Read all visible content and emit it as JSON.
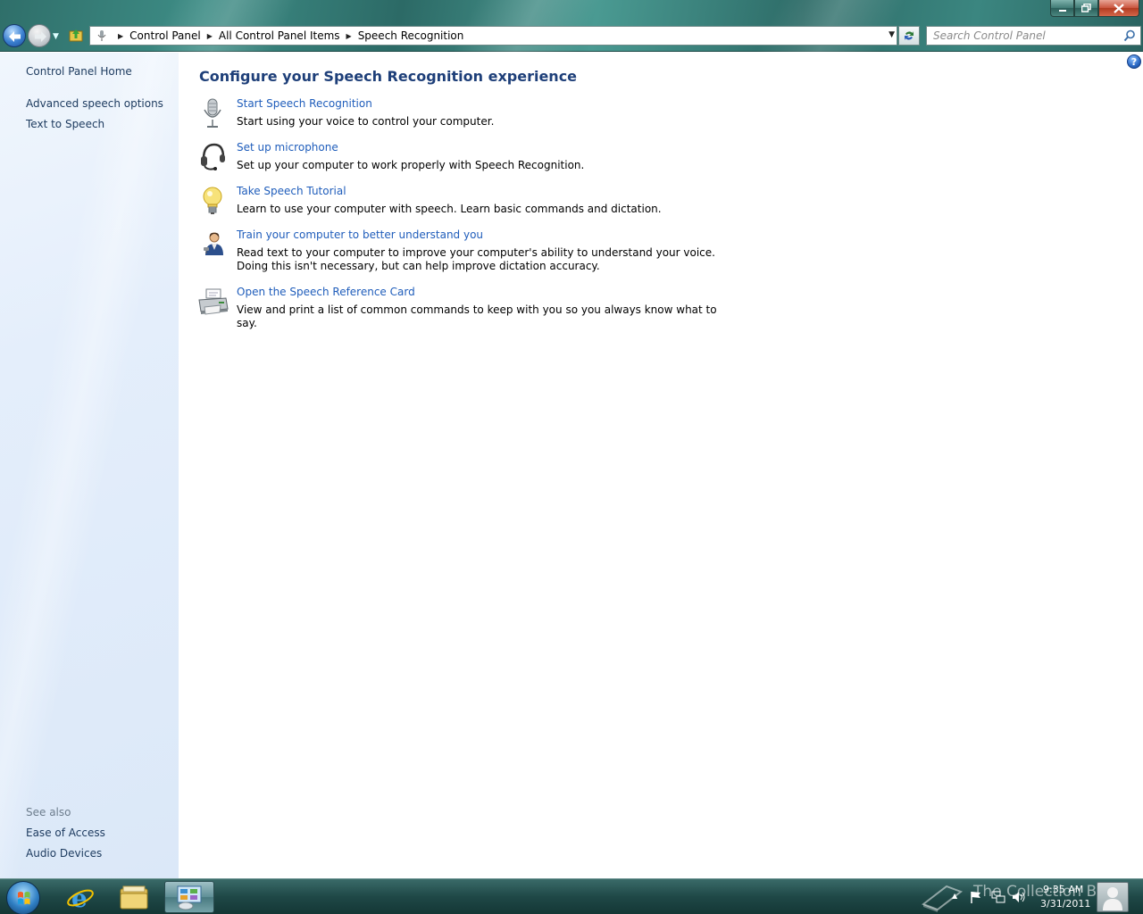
{
  "window": {
    "controls": {
      "minimize": "minimize",
      "maximize": "restore",
      "close": "close"
    }
  },
  "address_bar": {
    "crumbs": [
      "Control Panel",
      "All Control Panel Items",
      "Speech Recognition"
    ]
  },
  "search": {
    "placeholder": "Search Control Panel"
  },
  "sidebar": {
    "home": "Control Panel Home",
    "links": [
      "Advanced speech options",
      "Text to Speech"
    ],
    "see_also_heading": "See also",
    "see_also": [
      "Ease of Access",
      "Audio Devices"
    ]
  },
  "main": {
    "title": "Configure your Speech Recognition experience",
    "tasks": [
      {
        "icon": "microphone-icon",
        "link": "Start Speech Recognition",
        "desc": "Start using your voice to control your computer."
      },
      {
        "icon": "headset-icon",
        "link": "Set up microphone",
        "desc": "Set up your computer to work properly with Speech Recognition."
      },
      {
        "icon": "lightbulb-icon",
        "link": "Take Speech Tutorial",
        "desc": "Learn to use your computer with speech.  Learn basic commands and dictation."
      },
      {
        "icon": "user-training-icon",
        "link": "Train your computer to better understand you",
        "desc": "Read text to your computer to improve your computer's ability to understand your voice.  Doing this isn't necessary, but can help improve dictation accuracy."
      },
      {
        "icon": "printer-icon",
        "link": "Open the Speech Reference Card",
        "desc": "View and print a list of common commands to keep with you so you always know what to say."
      }
    ]
  },
  "taskbar": {
    "clock_time": "9:35 AM",
    "clock_date": "3/31/2011",
    "watermark": "The Collection Book",
    "pinned": [
      "internet-explorer-icon",
      "windows-explorer-icon",
      "control-panel-icon"
    ]
  },
  "colors": {
    "link": "#1f5dbb",
    "title": "#1e3f79",
    "sidebar_link": "#1c3a5e",
    "taskbar": "#1f4847"
  }
}
